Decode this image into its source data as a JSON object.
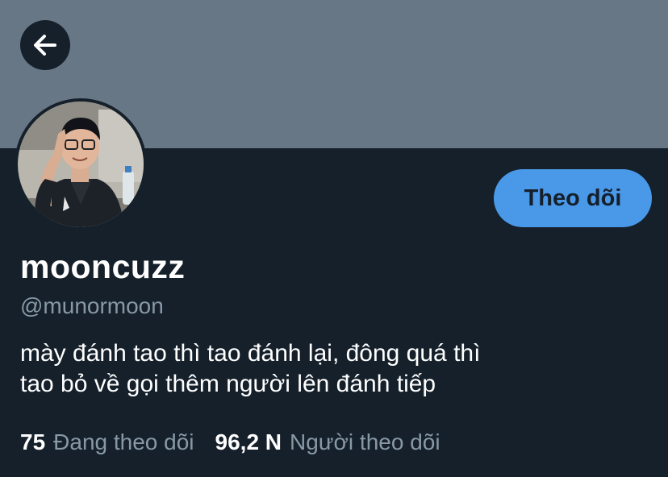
{
  "profile": {
    "display_name": "mooncuzz",
    "handle": "@munormoon",
    "bio_line1": "mày đánh tao thì tao đánh lại, đông quá thì",
    "bio_line2": "tao bỏ về gọi thêm người lên đánh tiếp",
    "avatar_icon": "profile-photo"
  },
  "actions": {
    "back_icon": "arrow-left-icon",
    "follow_label": "Theo dõi"
  },
  "stats": {
    "following_count": "75",
    "following_label": "Đang theo dõi",
    "followers_count": "96,2 N",
    "followers_label": "Người theo dõi"
  },
  "colors": {
    "background": "#15202b",
    "banner": "#687786",
    "accent": "#4a99e9",
    "secondary_text": "#8899a6"
  }
}
